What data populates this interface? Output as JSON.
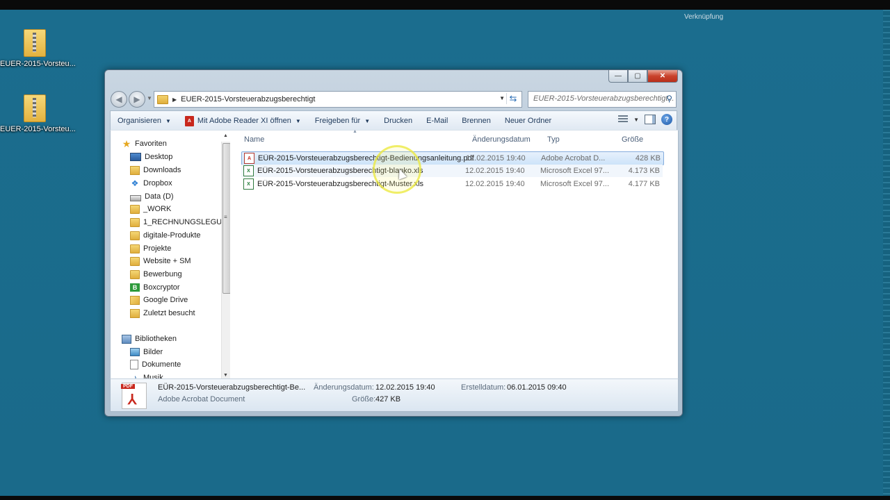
{
  "desktop": {
    "top_text": "Verknüpfung",
    "icons": [
      {
        "label": "EUER-2015-Vorsteu..."
      },
      {
        "label": "EUER-2015-Vorsteu..."
      }
    ]
  },
  "window": {
    "controls": {
      "minimize": "—",
      "maximize": "▢",
      "close": "✕"
    },
    "address": {
      "path": "EUER-2015-Vorsteuerabzugsberechtigt"
    },
    "search": {
      "placeholder": "EUER-2015-Vorsteuerabzugsberechtigt..."
    },
    "toolbar": {
      "organize": "Organisieren",
      "open_with": "Mit Adobe Reader XI öffnen",
      "share": "Freigeben für",
      "print": "Drucken",
      "email": "E-Mail",
      "burn": "Brennen",
      "new_folder": "Neuer Ordner"
    },
    "nav": {
      "favorites_header": "Favoriten",
      "favorites": [
        {
          "label": "Desktop"
        },
        {
          "label": "Downloads"
        },
        {
          "label": "Dropbox"
        },
        {
          "label": "Data (D)"
        },
        {
          "label": "_WORK"
        },
        {
          "label": "1_RECHNUNGSLEGUNG"
        },
        {
          "label": "digitale-Produkte"
        },
        {
          "label": "Projekte"
        },
        {
          "label": "Website + SM"
        },
        {
          "label": "Bewerbung"
        },
        {
          "label": "Boxcryptor"
        },
        {
          "label": "Google Drive"
        },
        {
          "label": "Zuletzt besucht"
        }
      ],
      "libraries_header": "Bibliotheken",
      "libraries": [
        {
          "label": "Bilder"
        },
        {
          "label": "Dokumente"
        },
        {
          "label": "Musik"
        }
      ]
    },
    "columns": {
      "name": "Name",
      "date": "Änderungsdatum",
      "type": "Typ",
      "size": "Größe"
    },
    "files": [
      {
        "name": "EÜR-2015-Vorsteuerabzugsberechtigt-Bedienungsanleitung.pdf",
        "date": "12.02.2015 19:40",
        "type": "Adobe Acrobat D...",
        "size": "428 KB",
        "kind": "pdf"
      },
      {
        "name": "EÜR-2015-Vorsteuerabzugsberechtigt-blanko.xls",
        "date": "12.02.2015 19:40",
        "type": "Microsoft Excel 97...",
        "size": "4.173 KB",
        "kind": "xls"
      },
      {
        "name": "EÜR-2015-Vorsteuerabzugsberechtigt-Muster.xls",
        "date": "12.02.2015 19:40",
        "type": "Microsoft Excel 97...",
        "size": "4.177 KB",
        "kind": "xls"
      }
    ],
    "details": {
      "filename": "EÜR-2015-Vorsteuerabzugsberechtigt-Be...",
      "filetype": "Adobe Acrobat Document",
      "modified_label": "Änderungsdatum:",
      "modified_value": "12.02.2015 19:40",
      "size_label": "Größe:",
      "size_value": "427 KB",
      "created_label": "Erstelldatum:",
      "created_value": "06.01.2015 09:40",
      "pdf_tag": "PDF"
    }
  }
}
